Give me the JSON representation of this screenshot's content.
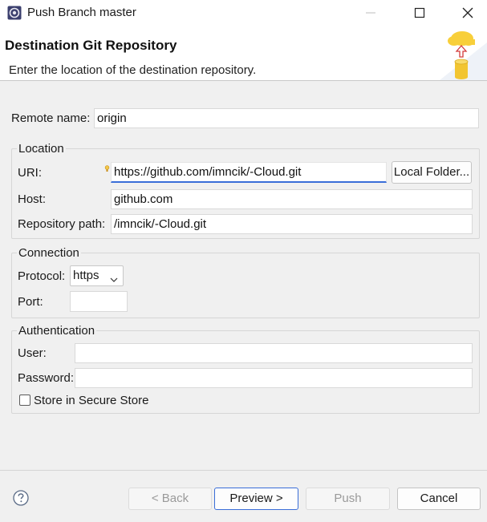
{
  "window": {
    "title": "Push Branch master"
  },
  "header": {
    "title": "Destination Git Repository",
    "description": "Enter the location of the destination repository.",
    "graphic_icon": "cloud-push-database-icon"
  },
  "remote": {
    "label": "Remote name:",
    "value": "origin"
  },
  "location": {
    "group_label": "Location",
    "uri_label": "URI:",
    "uri_value": "https://github.com/imncik/-Cloud.git",
    "local_folder_button": "Local Folder...",
    "host_label": "Host:",
    "host_value": "github.com",
    "repo_path_label": "Repository path:",
    "repo_path_value": "/imncik/-Cloud.git"
  },
  "connection": {
    "group_label": "Connection",
    "protocol_label": "Protocol:",
    "protocol_value": "https",
    "port_label": "Port:",
    "port_value": ""
  },
  "authentication": {
    "group_label": "Authentication",
    "user_label": "User:",
    "user_value": "",
    "password_label": "Password:",
    "password_value": "",
    "store_label": "Store in Secure Store",
    "store_checked": false
  },
  "buttons": {
    "back": "< Back",
    "preview": "Preview >",
    "push": "Push",
    "cancel": "Cancel"
  },
  "colors": {
    "accent": "#3a6ed8",
    "background": "#f0f0f0",
    "panel": "#ffffff"
  }
}
